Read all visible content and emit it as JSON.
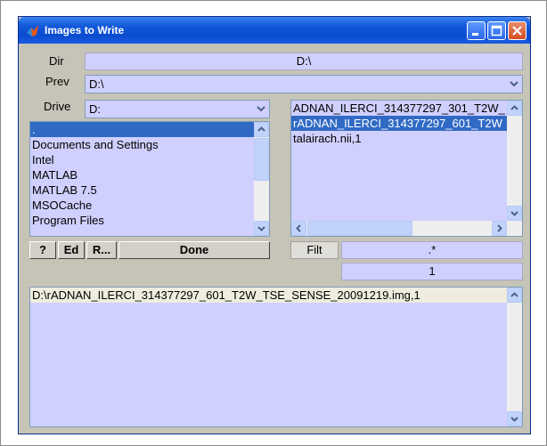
{
  "window": {
    "title": "Images to Write"
  },
  "dir": {
    "label": "Dir",
    "value": "D:\\"
  },
  "prev": {
    "label": "Prev",
    "value": "D:\\"
  },
  "drive": {
    "label": "Drive",
    "value": "D:"
  },
  "folders": [
    ".",
    "Documents and Settings",
    "Intel",
    "MATLAB",
    "MATLAB 7.5",
    "MSOCache",
    "Program Files"
  ],
  "files": [
    "ADNAN_ILERCI_314377297_301_T2W_",
    "rADNAN_ILERCI_314377297_601_T2W",
    "talairach.nii,1"
  ],
  "buttons": {
    "help": "?",
    "edit": "Ed",
    "recent": "R...",
    "done": "Done",
    "filter": "Filt"
  },
  "filter_value": ".*",
  "count": "1",
  "selected": [
    "D:\\rADNAN_ILERCI_314377297_601_T2W_TSE_SENSE_20091219.img,1"
  ],
  "colors": {
    "field_bg": "#d0d0ff",
    "selection": "#316ac5",
    "window_bg": "#c6c3b7",
    "titlebar": "#0a4bd0"
  }
}
